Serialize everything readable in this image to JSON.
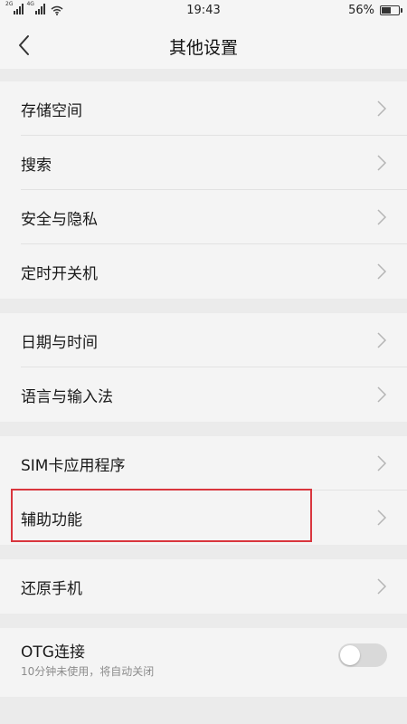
{
  "status_bar": {
    "net1_label": "2G",
    "net2_label": "4G",
    "time": "19:43",
    "battery_percent": "56%",
    "battery_level": 0.56
  },
  "header": {
    "title": "其他设置",
    "back_icon": "chevron-left-icon"
  },
  "groups": [
    {
      "items": [
        {
          "label": "存储空间"
        },
        {
          "label": "搜索"
        },
        {
          "label": "安全与隐私"
        },
        {
          "label": "定时开关机"
        }
      ]
    },
    {
      "items": [
        {
          "label": "日期与时间"
        },
        {
          "label": "语言与输入法"
        }
      ]
    },
    {
      "items": [
        {
          "label": "SIM卡应用程序"
        },
        {
          "label": "辅助功能"
        }
      ]
    },
    {
      "items": [
        {
          "label": "还原手机"
        }
      ]
    }
  ],
  "otg": {
    "title": "OTG连接",
    "subtitle": "10分钟未使用，将自动关闭",
    "enabled": false
  },
  "colors": {
    "background": "#ebebeb",
    "card": "#f4f4f4",
    "highlight": "#d9363e",
    "toggle_off": "#d9d9d9"
  }
}
